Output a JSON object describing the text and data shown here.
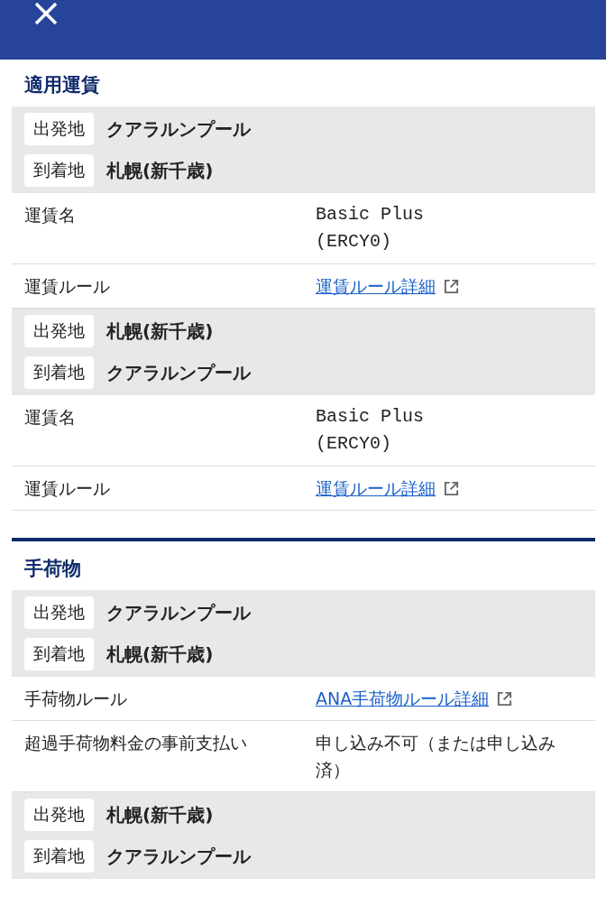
{
  "sections": [
    {
      "title": "適用運賃",
      "groups": [
        {
          "route": [
            {
              "label": "出発地",
              "value": "クアラルンプール"
            },
            {
              "label": "到着地",
              "value": "札幌(新千歳)"
            }
          ],
          "rows": [
            {
              "label": "運賃名",
              "kind": "code",
              "value": "Basic Plus (ERCY0)"
            },
            {
              "label": "運賃ルール",
              "kind": "link",
              "value": "運賃ルール詳細"
            }
          ]
        },
        {
          "route": [
            {
              "label": "出発地",
              "value": "札幌(新千歳)"
            },
            {
              "label": "到着地",
              "value": "クアラルンプール"
            }
          ],
          "rows": [
            {
              "label": "運賃名",
              "kind": "code",
              "value": "Basic Plus (ERCY0)"
            },
            {
              "label": "運賃ルール",
              "kind": "link",
              "value": "運賃ルール詳細"
            }
          ]
        }
      ]
    },
    {
      "title": "手荷物",
      "groups": [
        {
          "route": [
            {
              "label": "出発地",
              "value": "クアラルンプール"
            },
            {
              "label": "到着地",
              "value": "札幌(新千歳)"
            }
          ],
          "rows": [
            {
              "label": "手荷物ルール",
              "kind": "link",
              "value": "ANA手荷物ルール詳細"
            },
            {
              "label": "超過手荷物料金の事前支払い",
              "kind": "text",
              "value": "申し込み不可（または申し込み済）"
            }
          ]
        },
        {
          "route": [
            {
              "label": "出発地",
              "value": "札幌(新千歳)"
            },
            {
              "label": "到着地",
              "value": "クアラルンプール"
            }
          ]
        }
      ]
    }
  ]
}
